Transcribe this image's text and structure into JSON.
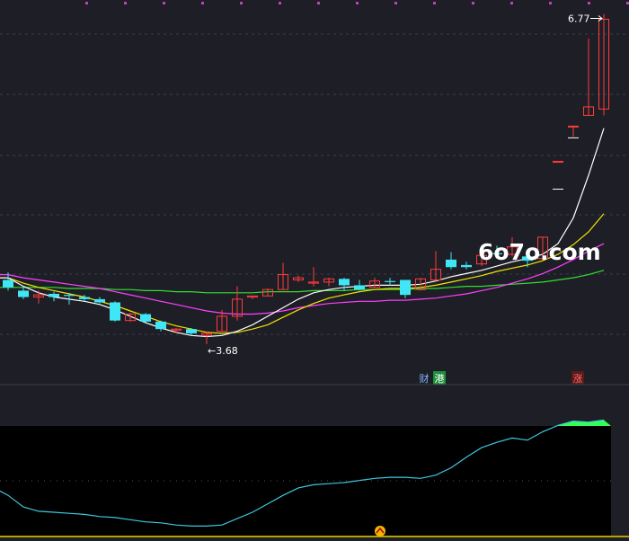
{
  "watermark": "6o7o.com",
  "badges": [
    {
      "text": "财",
      "color": "#7fb3ff",
      "bg": "#1e1f26"
    },
    {
      "text": "港",
      "color": "#ffffff",
      "bg": "#1e8f3a"
    },
    {
      "text": "涨",
      "color": "#ff6b6b",
      "bg": "#5a1a1a"
    }
  ],
  "colors": {
    "background": "#1e1f26",
    "grid": "#3a3c49",
    "up": "#ff3b3b",
    "down": "#40e6f5",
    "ma_white": "#ffffff",
    "ma_yellow": "#f2e600",
    "ma_magenta": "#ff40ff",
    "ma_green": "#33dd33",
    "osc_line": "#3ec8e0",
    "osc_fill": "#33ff55",
    "indicator_bg": "#000000",
    "axis_line": "#b8a000"
  },
  "chart_data": [
    {
      "type": "candlestick",
      "ylim": [
        3.3,
        6.85
      ],
      "max_label": "6.77",
      "min_label": "3.68",
      "candles": [
        {
          "o": 4.28,
          "h": 4.35,
          "l": 4.18,
          "c": 4.21
        },
        {
          "o": 4.18,
          "h": 4.22,
          "l": 4.1,
          "c": 4.12
        },
        {
          "o": 4.12,
          "h": 4.18,
          "l": 4.06,
          "c": 4.14
        },
        {
          "o": 4.15,
          "h": 4.17,
          "l": 4.08,
          "c": 4.12
        },
        {
          "o": 4.14,
          "h": 4.16,
          "l": 4.05,
          "c": 4.13
        },
        {
          "o": 4.12,
          "h": 4.14,
          "l": 4.08,
          "c": 4.1
        },
        {
          "o": 4.1,
          "h": 4.12,
          "l": 4.06,
          "c": 4.07
        },
        {
          "o": 4.07,
          "h": 4.08,
          "l": 3.89,
          "c": 3.9
        },
        {
          "o": 3.9,
          "h": 3.97,
          "l": 3.89,
          "c": 3.96
        },
        {
          "o": 3.96,
          "h": 3.97,
          "l": 3.88,
          "c": 3.89
        },
        {
          "o": 3.89,
          "h": 3.9,
          "l": 3.8,
          "c": 3.82
        },
        {
          "o": 3.81,
          "h": 3.83,
          "l": 3.78,
          "c": 3.82
        },
        {
          "o": 3.82,
          "h": 3.83,
          "l": 3.76,
          "c": 3.78
        },
        {
          "o": 3.76,
          "h": 3.8,
          "l": 3.68,
          "c": 3.78
        },
        {
          "o": 3.8,
          "h": 4.0,
          "l": 3.8,
          "c": 3.94
        },
        {
          "o": 3.94,
          "h": 4.22,
          "l": 3.9,
          "c": 4.1
        },
        {
          "o": 4.12,
          "h": 4.13,
          "l": 4.1,
          "c": 4.13
        },
        {
          "o": 4.13,
          "h": 4.2,
          "l": 4.13,
          "c": 4.19
        },
        {
          "o": 4.19,
          "h": 4.44,
          "l": 4.19,
          "c": 4.33
        },
        {
          "o": 4.28,
          "h": 4.32,
          "l": 4.26,
          "c": 4.3
        },
        {
          "o": 4.25,
          "h": 4.4,
          "l": 4.22,
          "c": 4.26
        },
        {
          "o": 4.26,
          "h": 4.3,
          "l": 4.22,
          "c": 4.29
        },
        {
          "o": 4.29,
          "h": 4.3,
          "l": 4.18,
          "c": 4.23
        },
        {
          "o": 4.23,
          "h": 4.28,
          "l": 4.18,
          "c": 4.19
        },
        {
          "o": 4.21,
          "h": 4.3,
          "l": 4.21,
          "c": 4.27
        },
        {
          "o": 4.27,
          "h": 4.3,
          "l": 4.23,
          "c": 4.26
        },
        {
          "o": 4.28,
          "h": 4.28,
          "l": 4.11,
          "c": 4.14
        },
        {
          "o": 4.19,
          "h": 4.3,
          "l": 4.18,
          "c": 4.29
        },
        {
          "o": 4.28,
          "h": 4.55,
          "l": 4.27,
          "c": 4.38
        },
        {
          "o": 4.47,
          "h": 4.54,
          "l": 4.38,
          "c": 4.4
        },
        {
          "o": 4.42,
          "h": 4.45,
          "l": 4.38,
          "c": 4.4
        },
        {
          "o": 4.43,
          "h": 4.6,
          "l": 4.41,
          "c": 4.51
        },
        {
          "o": 4.53,
          "h": 4.6,
          "l": 4.48,
          "c": 4.52
        },
        {
          "o": 4.52,
          "h": 4.68,
          "l": 4.5,
          "c": 4.59
        },
        {
          "o": 4.5,
          "h": 4.55,
          "l": 4.4,
          "c": 4.46
        },
        {
          "o": 4.48,
          "h": 4.68,
          "l": 4.47,
          "c": 4.68
        },
        {
          "o": 5.39,
          "h": 5.39,
          "l": 5.39,
          "c": 5.39
        },
        {
          "o": 5.72,
          "h": 5.72,
          "l": 5.62,
          "c": 5.72
        },
        {
          "o": 5.82,
          "h": 6.54,
          "l": 5.82,
          "c": 5.9
        },
        {
          "o": 5.88,
          "h": 6.77,
          "l": 5.82,
          "c": 6.72
        }
      ],
      "ma_white": [
        4.3,
        4.22,
        4.16,
        4.12,
        4.1,
        4.08,
        4.05,
        4.0,
        3.94,
        3.88,
        3.83,
        3.79,
        3.76,
        3.75,
        3.76,
        3.8,
        3.86,
        3.94,
        4.02,
        4.1,
        4.16,
        4.19,
        4.21,
        4.22,
        4.23,
        4.23,
        4.23,
        4.24,
        4.27,
        4.31,
        4.34,
        4.37,
        4.41,
        4.45,
        4.48,
        4.52,
        4.62,
        4.86,
        5.26,
        5.7
      ],
      "ma_yellow": [
        4.3,
        4.25,
        4.21,
        4.18,
        4.15,
        4.12,
        4.08,
        4.04,
        3.99,
        3.94,
        3.89,
        3.85,
        3.82,
        3.79,
        3.78,
        3.79,
        3.82,
        3.86,
        3.93,
        4.0,
        4.06,
        4.11,
        4.14,
        4.17,
        4.19,
        4.2,
        4.2,
        4.21,
        4.23,
        4.26,
        4.29,
        4.32,
        4.36,
        4.39,
        4.42,
        4.46,
        4.52,
        4.61,
        4.73,
        4.9
      ],
      "ma_magenta": [
        4.33,
        4.3,
        4.28,
        4.26,
        4.24,
        4.22,
        4.2,
        4.17,
        4.14,
        4.11,
        4.08,
        4.05,
        4.02,
        3.99,
        3.97,
        3.96,
        3.96,
        3.97,
        3.99,
        4.02,
        4.04,
        4.06,
        4.07,
        4.08,
        4.08,
        4.09,
        4.09,
        4.1,
        4.11,
        4.13,
        4.15,
        4.18,
        4.21,
        4.25,
        4.29,
        4.34,
        4.4,
        4.47,
        4.55,
        4.62
      ],
      "ma_green": [
        4.21,
        4.21,
        4.21,
        4.21,
        4.2,
        4.2,
        4.2,
        4.19,
        4.19,
        4.18,
        4.18,
        4.17,
        4.17,
        4.16,
        4.16,
        4.16,
        4.16,
        4.17,
        4.17,
        4.17,
        4.18,
        4.18,
        4.18,
        4.19,
        4.19,
        4.19,
        4.19,
        4.2,
        4.2,
        4.21,
        4.22,
        4.22,
        4.23,
        4.24,
        4.25,
        4.26,
        4.28,
        4.3,
        4.33,
        4.37
      ],
      "dash_marks": [
        {
          "price": 5.13
        },
        {
          "price": 5.61
        }
      ]
    },
    {
      "type": "area",
      "ylim": [
        0,
        100
      ],
      "values": [
        38,
        27,
        23,
        22,
        21,
        20,
        18,
        17,
        15,
        13,
        12,
        10,
        9,
        9,
        10,
        16,
        22,
        30,
        38,
        45,
        48,
        49,
        50,
        52,
        54,
        55,
        55,
        54,
        57,
        64,
        74,
        83,
        88,
        92,
        90,
        98,
        104,
        108,
        107,
        109
      ]
    }
  ]
}
